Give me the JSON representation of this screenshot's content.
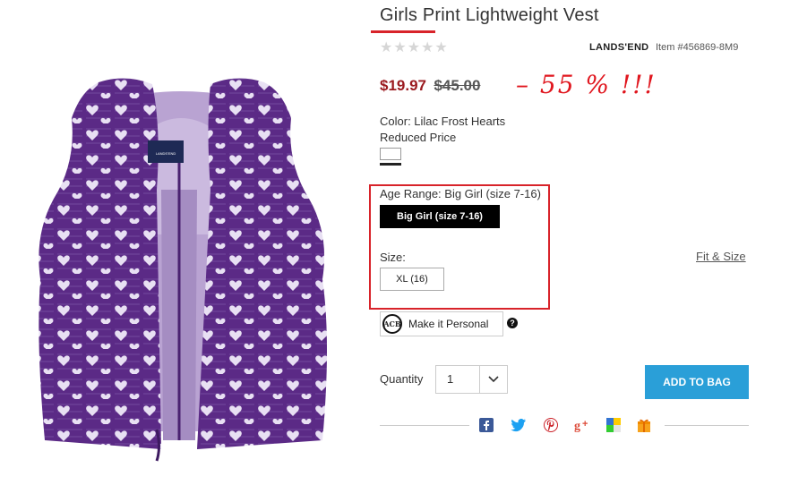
{
  "product": {
    "title": "Girls Print Lightweight Vest",
    "rating_stars": "★★★★★",
    "brand": "LANDS'END",
    "item_number": "Item #456869-8M9",
    "sale_price": "$19.97",
    "original_price": "$45.00",
    "discount_note": "– 55 % !!!",
    "label_tag": "LANDS'END"
  },
  "options": {
    "color_label": "Color: Lilac Frost Hearts",
    "reduced_label": "Reduced Price",
    "age_range_label": "Age Range: Big Girl (size 7-16)",
    "age_range_button": "Big Girl (size 7-16)",
    "size_label": "Size:",
    "size_button": "XL (16)",
    "fit_link": "Fit & Size"
  },
  "personalize": {
    "monogram": "ACB",
    "label": "Make it Personal",
    "help": "?"
  },
  "purchase": {
    "quantity_label": "Quantity",
    "quantity_value": "1",
    "add_button": "ADD TO BAG"
  },
  "share_icons": [
    "facebook-icon",
    "twitter-icon",
    "pinterest-icon",
    "google-plus-icon",
    "delicious-icon",
    "gift-icon"
  ],
  "colors": {
    "accent_red": "#d8232a",
    "sale_price": "#9b1b20",
    "add_button": "#2a9fd8",
    "vest_purple": "#5b2a86",
    "vest_lining": "#b9a3d2"
  }
}
